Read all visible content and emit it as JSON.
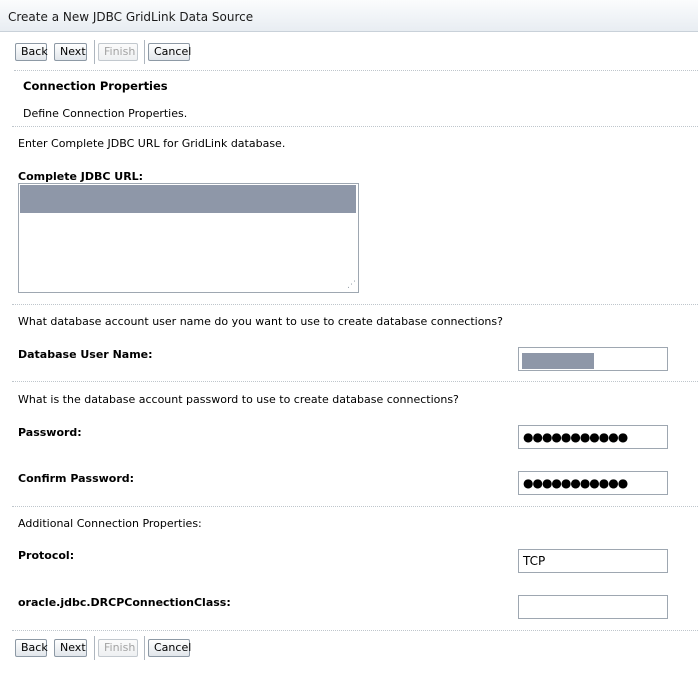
{
  "header": {
    "title": "Create a New JDBC GridLink Data Source"
  },
  "buttons": {
    "back": "Back",
    "next": "Next",
    "finish": "Finish",
    "cancel": "Cancel"
  },
  "section": {
    "title": "Connection Properties",
    "description": "Define Connection Properties."
  },
  "url": {
    "prompt": "Enter Complete JDBC URL for GridLink database.",
    "label": "Complete JDBC URL:",
    "value": ""
  },
  "username": {
    "prompt": "What database account user name do you want to use to create database connections?",
    "label": "Database User Name:",
    "value": ""
  },
  "password": {
    "prompt": "What is the database account password to use to create database connections?",
    "label": "Password:",
    "value": "●●●●●●●●●●●",
    "confirm_label": "Confirm Password:",
    "confirm_value": "●●●●●●●●●●●"
  },
  "additional": {
    "prompt": "Additional Connection Properties:",
    "protocol_label": "Protocol:",
    "protocol_value": "TCP",
    "drcp_label": "oracle.jdbc.DRCPConnectionClass:",
    "drcp_value": ""
  },
  "colors": {
    "selection": "#8e97a8",
    "header_bg": "#e8edf2",
    "disabled_text": "#a3a3a3"
  }
}
